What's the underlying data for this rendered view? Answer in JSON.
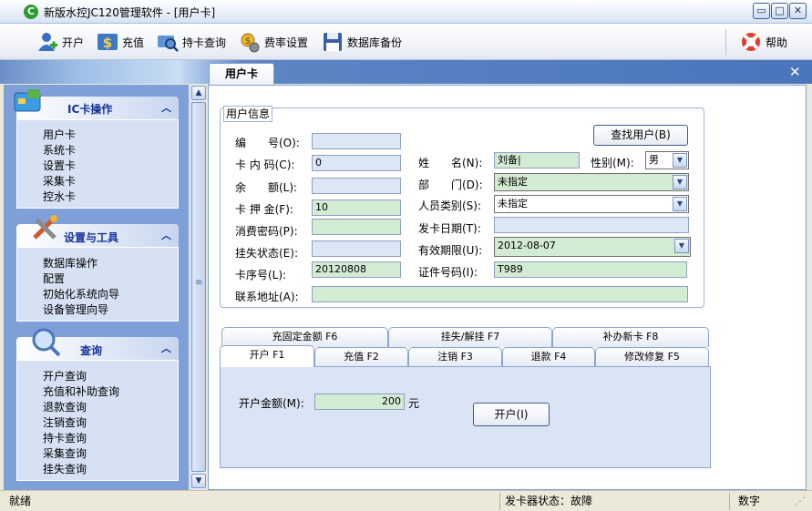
{
  "window": {
    "title": "新版水控JC120管理软件 - [用户卡]",
    "icon": "app-logo-icon"
  },
  "window_buttons": {
    "minimize": "▭",
    "maximize": "□",
    "close": "✕"
  },
  "toolbar": {
    "open_card": "开户",
    "recharge": "充值",
    "card_query": "持卡查询",
    "rate_settings": "费率设置",
    "db_backup": "数据库备份",
    "help": "帮助"
  },
  "tab": {
    "user_card": "用户卡"
  },
  "sidebar": {
    "groups": [
      {
        "title": "IC卡操作",
        "items": [
          "用户卡",
          "系统卡",
          "设置卡",
          "采集卡",
          "控水卡"
        ]
      },
      {
        "title": "设置与工具",
        "items": [
          "数据库操作",
          "配置",
          "初始化系统向导",
          "设备管理向导"
        ]
      },
      {
        "title": "查询",
        "items": [
          "开户查询",
          "充值和补助查询",
          "退款查询",
          "注销查询",
          "持卡查询",
          "采集查询",
          "挂失查询"
        ]
      }
    ],
    "chevron": "︿"
  },
  "user_info": {
    "legend": "用户信息",
    "find_user_button": "查找用户(B)",
    "fields": {
      "number_label": "编　　号(O):",
      "number_value": "",
      "card_code_label": "卡 内 码(C):",
      "card_code_value": "0",
      "balance_label": "余　　额(L):",
      "balance_value": "",
      "deposit_label": "卡 押 金(F):",
      "deposit_value": "10",
      "pwd_label": "消费密码(P):",
      "pwd_value": "",
      "loss_label": "挂失状态(E):",
      "loss_value": "",
      "serial_label": "卡序号(L):",
      "serial_value": "20120808",
      "address_label": "联系地址(A):",
      "address_value": "",
      "name_label": "姓　　名(N):",
      "name_value": "刘备|",
      "gender_label": "性别(M):",
      "gender_value": "男",
      "dept_label": "部　　门(D):",
      "dept_value": "未指定",
      "type_label": "人员类别(S):",
      "type_value": "未指定",
      "issue_date_label": "发卡日期(T):",
      "issue_date_value": "",
      "expiry_label": "有效期限(U):",
      "expiry_value": "2012-08-07",
      "id_label": "证件号码(I):",
      "id_value": "T989"
    }
  },
  "op_tabs": {
    "row1": [
      "充固定金额 F6",
      "挂失/解挂 F7",
      "补办新卡 F8"
    ],
    "row2": [
      "开户 F1",
      "充值 F2",
      "注销 F3",
      "退款 F4",
      "修改修复 F5"
    ]
  },
  "open_panel": {
    "amount_label": "开户金额(M):",
    "amount_value": "200",
    "unit": "元",
    "open_button": "开户(I)"
  },
  "status": {
    "ready": "就绪",
    "reader_status": "发卡器状态：故障",
    "mode": "数字"
  },
  "scroll": {
    "up": "▲",
    "down": "▼",
    "grip": "≡"
  }
}
